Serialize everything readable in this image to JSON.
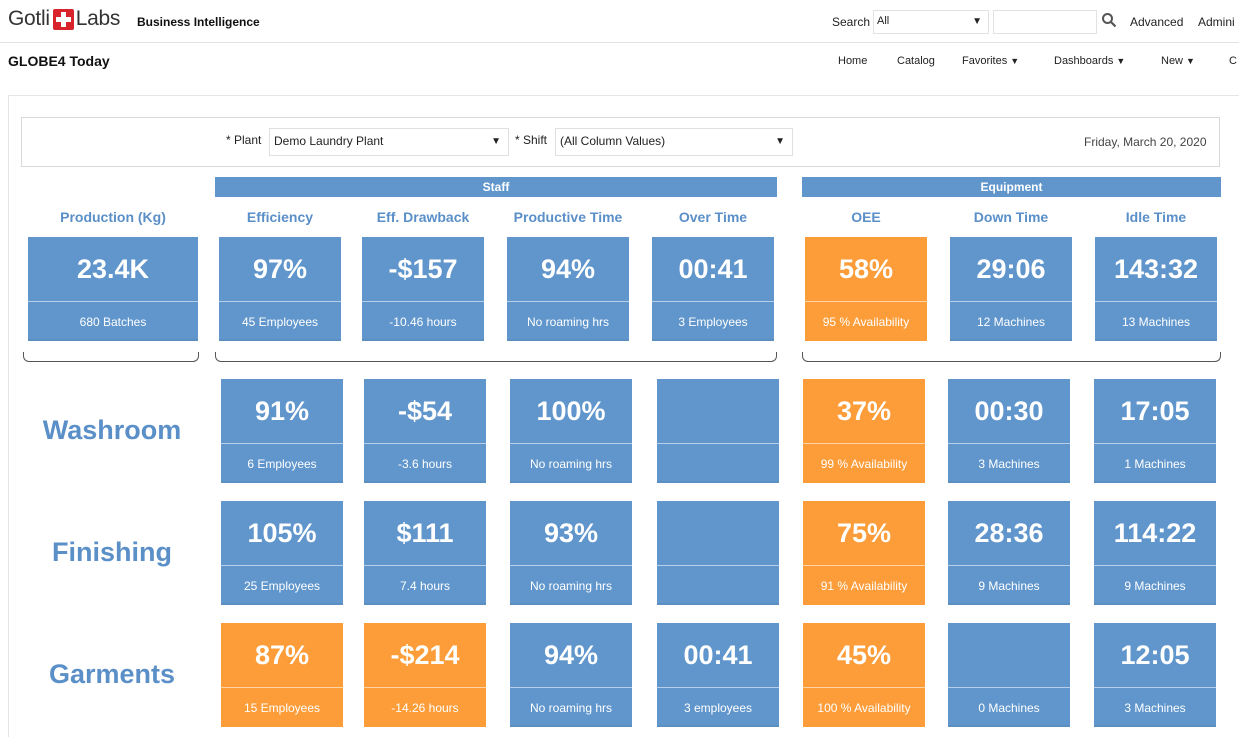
{
  "app": {
    "logo_left": "Gotli",
    "logo_right": "Labs",
    "name": "Business Intelligence"
  },
  "topbar": {
    "search_label": "Search",
    "search_scope": "All",
    "advanced": "Advanced",
    "admin": "Admini"
  },
  "page": {
    "title": "GLOBE4 Today"
  },
  "nav": {
    "home": "Home",
    "catalog": "Catalog",
    "favorites": "Favorites",
    "dashboards": "Dashboards",
    "new": "New",
    "more": "C"
  },
  "prompts": {
    "plant_label": "* Plant",
    "plant_value": "Demo Laundry Plant",
    "shift_label": "* Shift",
    "shift_value": "(All Column Values)",
    "date": "Friday, March 20, 2020"
  },
  "groups": {
    "staff": "Staff",
    "equipment": "Equipment"
  },
  "columns": {
    "production": "Production (Kg)",
    "efficiency": "Efficiency",
    "drawback": "Eff. Drawback",
    "productive": "Productive Time",
    "overtime": "Over Time",
    "oee": "OEE",
    "downtime": "Down Time",
    "idletime": "Idle Time"
  },
  "colors": {
    "blue": "#6096cc",
    "orange": "#fc9d3a",
    "label": "#5a8fc8"
  },
  "summary": {
    "production": {
      "value": "23.4K",
      "sub": "680 Batches"
    },
    "efficiency": {
      "value": "97%",
      "sub": "45 Employees"
    },
    "drawback": {
      "value": "-$157",
      "sub": "-10.46 hours"
    },
    "productive": {
      "value": "94%",
      "sub": "No roaming hrs"
    },
    "overtime": {
      "value": "00:41",
      "sub": "3 Employees"
    },
    "oee": {
      "value": "58%",
      "sub": "95 % Availability"
    },
    "downtime": {
      "value": "29:06",
      "sub": "12 Machines"
    },
    "idletime": {
      "value": "143:32",
      "sub": "13 Machines"
    }
  },
  "rows": [
    {
      "label": "Washroom",
      "efficiency": {
        "value": "91%",
        "sub": "6 Employees"
      },
      "drawback": {
        "value": "-$54",
        "sub": "-3.6 hours"
      },
      "productive": {
        "value": "100%",
        "sub": "No roaming hrs"
      },
      "overtime": {
        "value": "",
        "sub": ""
      },
      "oee": {
        "value": "37%",
        "sub": "99 % Availability"
      },
      "downtime": {
        "value": "00:30",
        "sub": "3 Machines"
      },
      "idletime": {
        "value": "17:05",
        "sub": "1 Machines"
      }
    },
    {
      "label": "Finishing",
      "efficiency": {
        "value": "105%",
        "sub": "25 Employees"
      },
      "drawback": {
        "value": "$111",
        "sub": "7.4 hours"
      },
      "productive": {
        "value": "93%",
        "sub": "No roaming hrs"
      },
      "overtime": {
        "value": "",
        "sub": ""
      },
      "oee": {
        "value": "75%",
        "sub": "91 % Availability"
      },
      "downtime": {
        "value": "28:36",
        "sub": "9 Machines"
      },
      "idletime": {
        "value": "114:22",
        "sub": "9 Machines"
      }
    },
    {
      "label": "Garments",
      "efficiency": {
        "value": "87%",
        "sub": "15 Employees"
      },
      "drawback": {
        "value": "-$214",
        "sub": "-14.26 hours"
      },
      "productive": {
        "value": "94%",
        "sub": "No roaming hrs"
      },
      "overtime": {
        "value": "00:41",
        "sub": "3 employees"
      },
      "oee": {
        "value": "45%",
        "sub": "100 % Availability"
      },
      "downtime": {
        "value": "",
        "sub": "0 Machines"
      },
      "idletime": {
        "value": "12:05",
        "sub": "3 Machines"
      }
    }
  ]
}
